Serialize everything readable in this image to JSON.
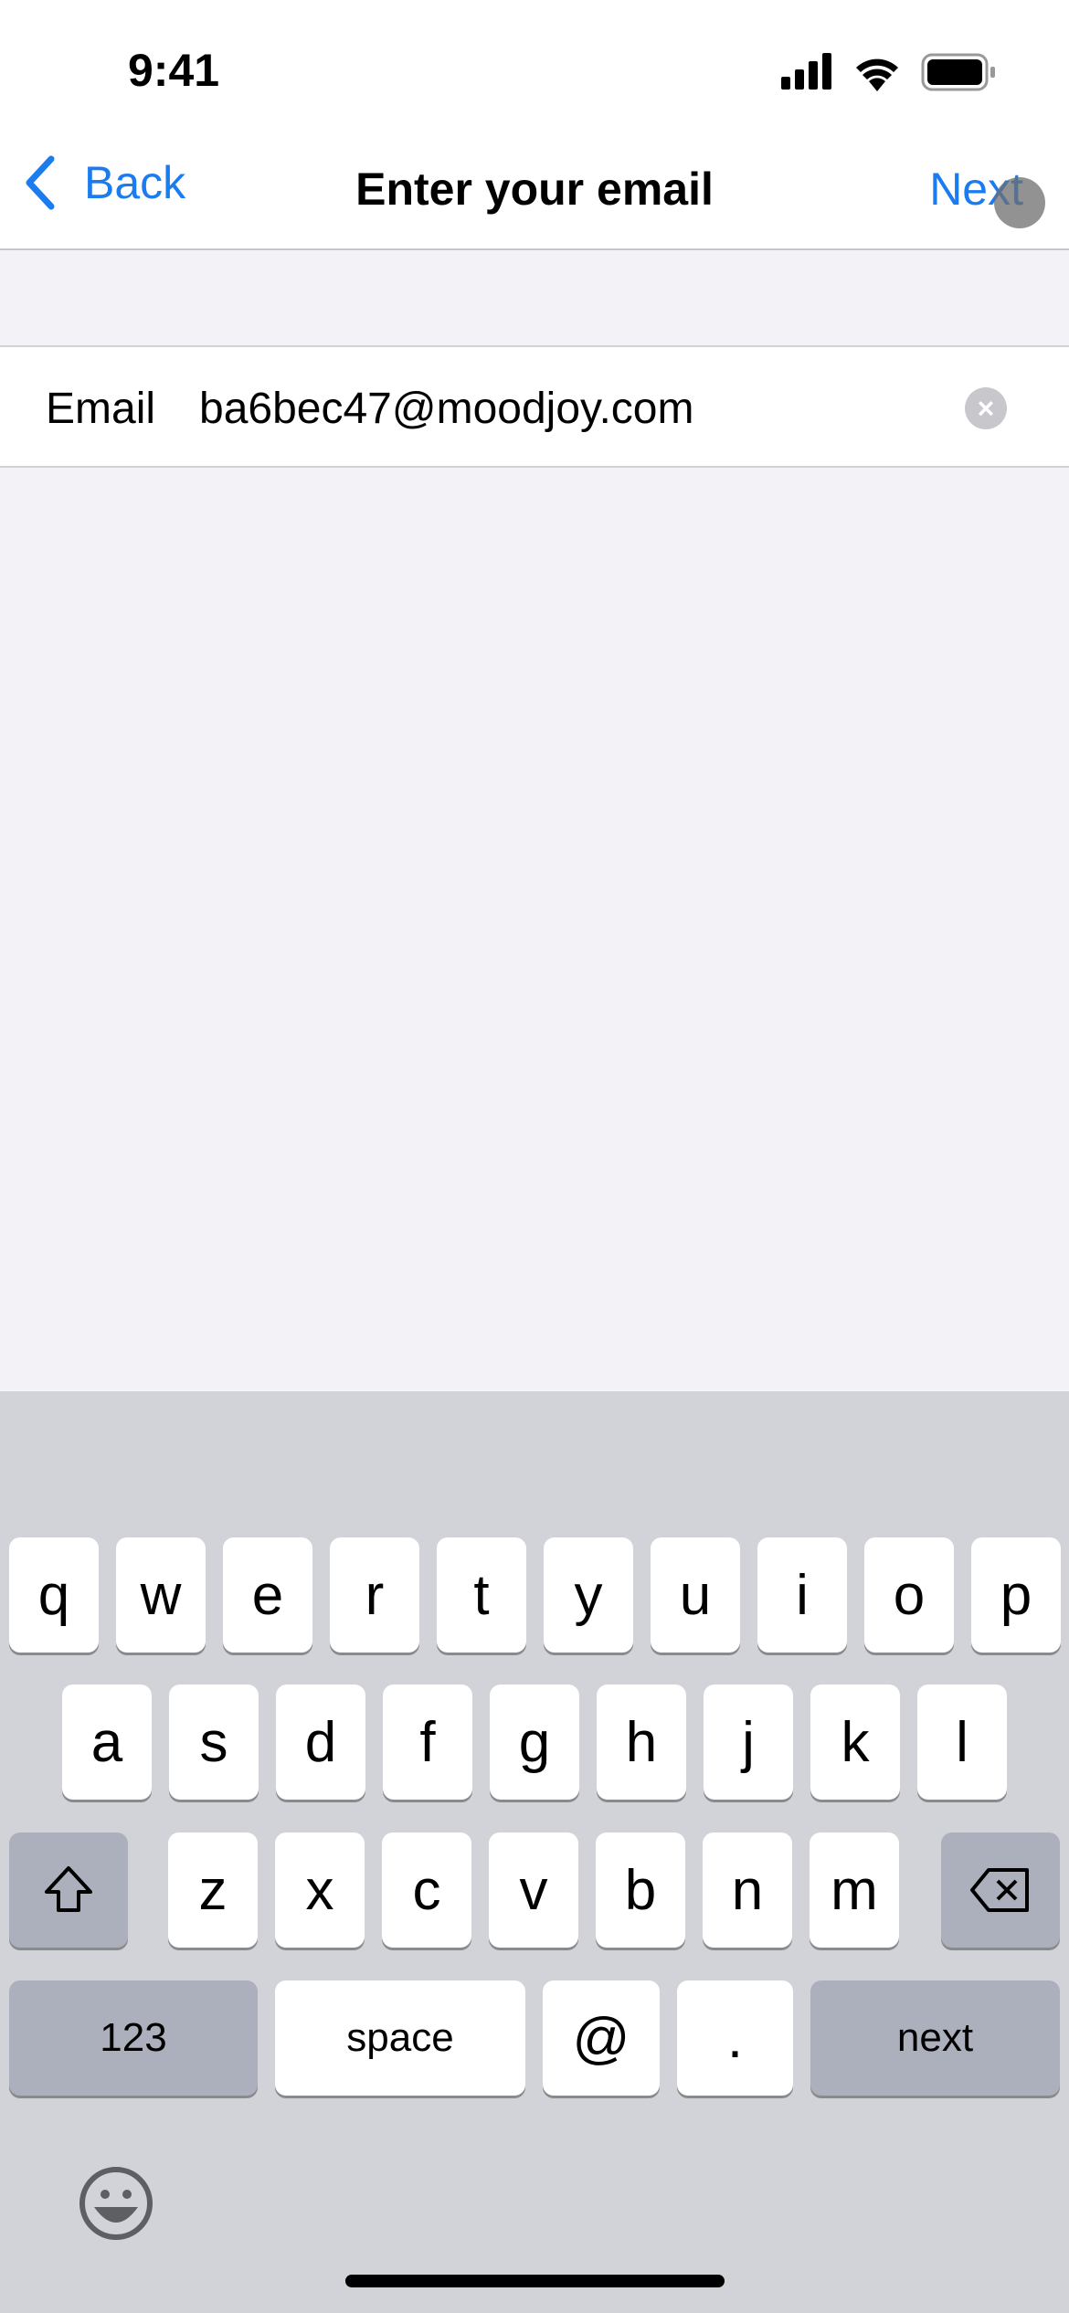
{
  "status_bar": {
    "time": "9:41",
    "icons": [
      "signal-icon",
      "wifi-icon",
      "battery-icon"
    ]
  },
  "nav": {
    "back_label": "Back",
    "title": "Enter your email",
    "next_label": "Next"
  },
  "form": {
    "email_label": "Email",
    "email_value": "ba6bec47@moodjoy.com",
    "clear_icon": "clear-icon"
  },
  "keyboard": {
    "row1": [
      "q",
      "w",
      "e",
      "r",
      "t",
      "y",
      "u",
      "i",
      "o",
      "p"
    ],
    "row2": [
      "a",
      "s",
      "d",
      "f",
      "g",
      "h",
      "j",
      "k",
      "l"
    ],
    "row3": [
      "z",
      "x",
      "c",
      "v",
      "b",
      "n",
      "m"
    ],
    "numbers_label": "123",
    "space_label": "space",
    "at_label": "@",
    "dot_label": ".",
    "return_label": "next"
  },
  "colors": {
    "accent": "#1b7cf0",
    "keyboard_bg": "#d1d3d9"
  }
}
